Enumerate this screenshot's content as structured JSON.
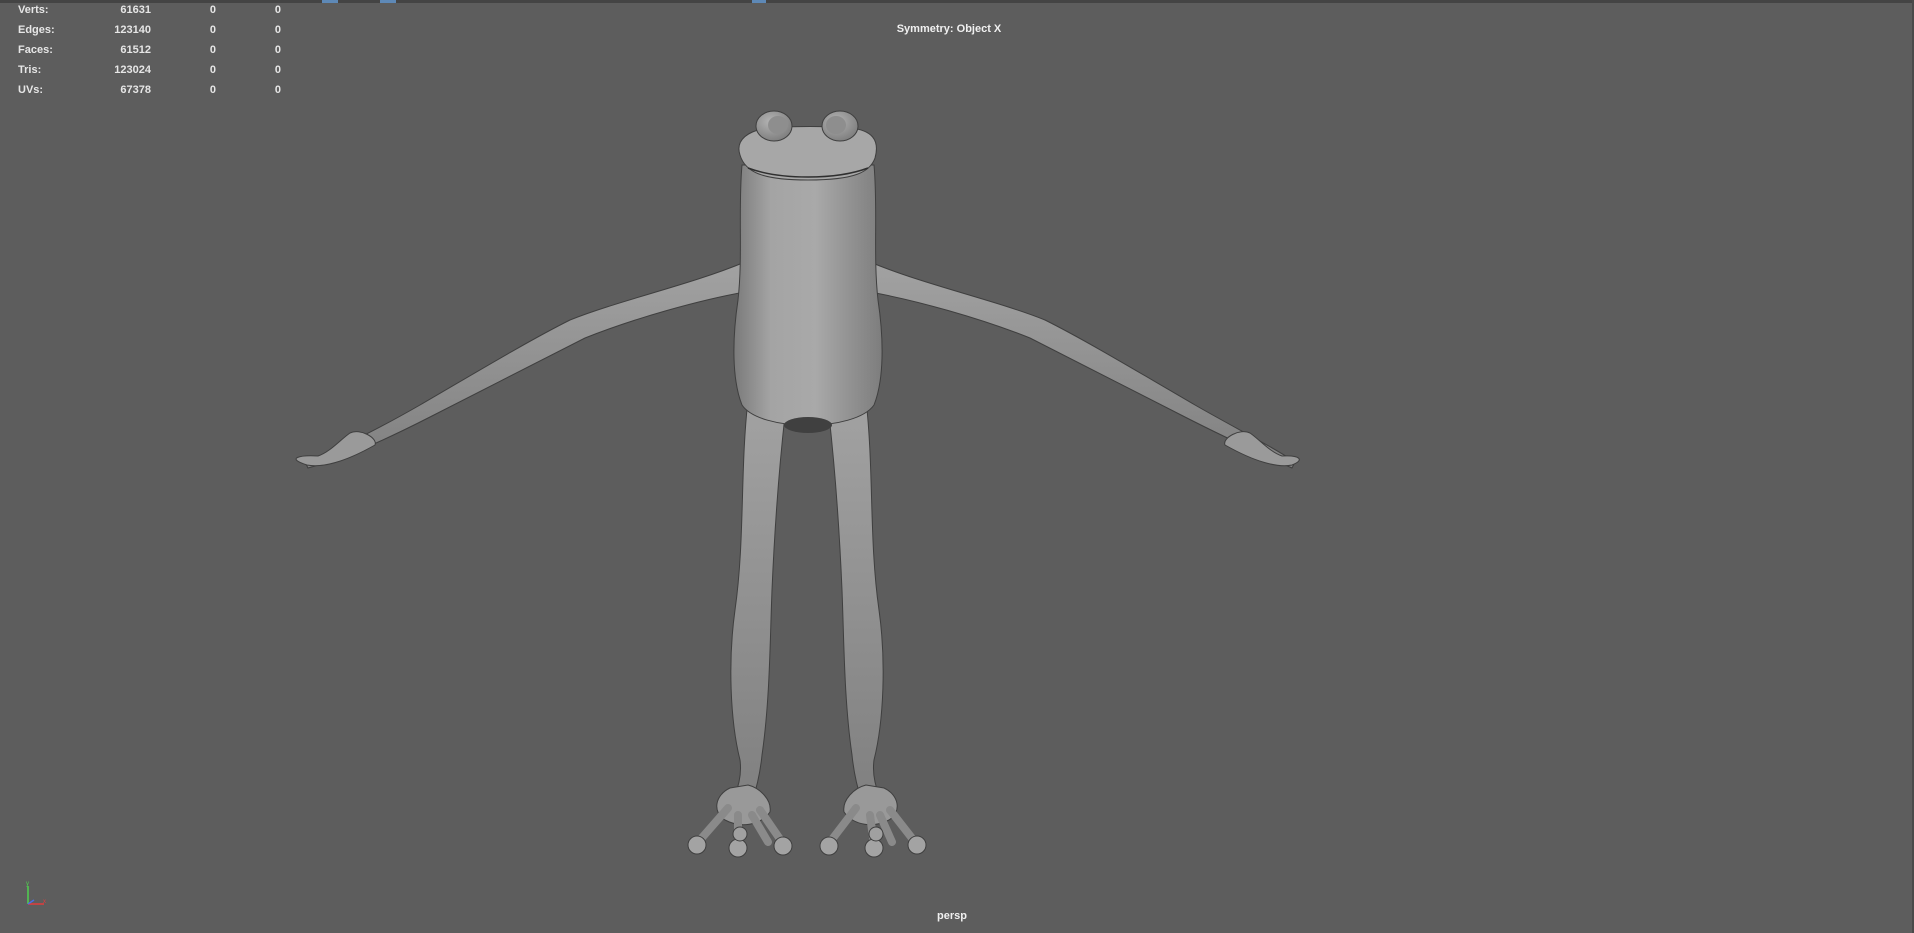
{
  "window": {
    "accent_color": "#5e89b7",
    "background_color": "#5d5d5d"
  },
  "hud": {
    "rows": [
      {
        "label": "Verts:",
        "values": [
          "61631",
          "0",
          "0"
        ]
      },
      {
        "label": "Edges:",
        "values": [
          "123140",
          "0",
          "0"
        ]
      },
      {
        "label": "Faces:",
        "values": [
          "61512",
          "0",
          "0"
        ]
      },
      {
        "label": "Tris:",
        "values": [
          "123024",
          "0",
          "0"
        ]
      },
      {
        "label": "UVs:",
        "values": [
          "67378",
          "0",
          "0"
        ]
      }
    ]
  },
  "symmetry": "Symmetry: Object X",
  "camera": "persp",
  "axis": {
    "icon": "view-axis-icon",
    "x_color": "#e23c3c",
    "y_color": "#4fd14f",
    "z_color": "#4a6fe8"
  },
  "model": {
    "icon": "frog-mesh",
    "shade_color": "#9e9e9e"
  }
}
